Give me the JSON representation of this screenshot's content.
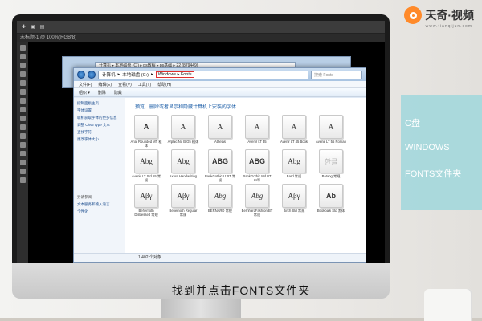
{
  "logo": {
    "name": "天奇·视频",
    "url": "www.tianqijun.com"
  },
  "photoshop": {
    "tab": "未标题-1 @ 100%(RGB/8)"
  },
  "explorer": {
    "back_address": "计算机 ▸ 本地磁盘 (C:) ▸ ps教程 ▸ ps基础 ▸ 22 (879449)",
    "crumbs": [
      "计算机",
      "本地磁盘 (C:)",
      "Windows",
      "Fonts"
    ],
    "search_placeholder": "搜索 Fonts",
    "menu": [
      "文件(F)",
      "编辑(E)",
      "查看(V)",
      "工具(T)",
      "帮助(H)"
    ],
    "toolbar": [
      "组织 ▾",
      "删除",
      "隐藏"
    ],
    "sidebar_top": [
      "控制面板主页",
      "字体设置",
      "联机获取字体的更多信息",
      "调整 ClearType 文本",
      "查找字符",
      "更改字体大小"
    ],
    "sidebar_bottom_head": "另请参阅",
    "sidebar_bottom": [
      "文本服务和输入语言",
      "个性化"
    ],
    "heading": "预览、删除或者显示和隐藏计算机上安装的字体",
    "fonts": [
      {
        "glyph": "A",
        "name": "Arial Rounded MT 粗体",
        "style": "bold"
      },
      {
        "glyph": "A",
        "name": "Arphic Nu BIG5 粗体",
        "style": ""
      },
      {
        "glyph": "A",
        "name": "Athelas",
        "style": ""
      },
      {
        "glyph": "A",
        "name": "Avenir LT 35",
        "style": ""
      },
      {
        "glyph": "A",
        "name": "Avenir LT 45 Book",
        "style": ""
      },
      {
        "glyph": "A",
        "name": "Avenir LT 55 Roman",
        "style": ""
      },
      {
        "glyph": "Abg",
        "name": "Avenir LT Std 55 常规",
        "style": ""
      },
      {
        "glyph": "Abg",
        "name": "Axure Handwriting",
        "style": ""
      },
      {
        "glyph": "ABG",
        "name": "BankGothic Lt BT 常规",
        "style": "bold"
      },
      {
        "glyph": "ABG",
        "name": "BankGothic Md BT 中等",
        "style": "bold"
      },
      {
        "glyph": "Abg",
        "name": "Bard 常规",
        "style": ""
      },
      {
        "glyph": "한글",
        "name": "Batang 常规",
        "style": "light"
      },
      {
        "glyph": "Aβγ",
        "name": "Behemoth Distressed 常规",
        "style": ""
      },
      {
        "glyph": "Aβγ",
        "name": "Behemoth Regular 常规",
        "style": ""
      },
      {
        "glyph": "Abg",
        "name": "BERNARD 常规",
        "style": "italic"
      },
      {
        "glyph": "Abg",
        "name": "BernhardFashion BT 常规",
        "style": "italic"
      },
      {
        "glyph": "Aβγ",
        "name": "Birch Std 常规",
        "style": ""
      },
      {
        "glyph": "Ab",
        "name": "Bookbalk Std 黑体",
        "style": "bold"
      }
    ],
    "status": "1,402 个对象"
  },
  "panel": {
    "lines": [
      "C盘",
      "WINDOWS",
      "FONTS文件夹"
    ]
  },
  "subtitle": "找到并点击FONTS文件夹"
}
